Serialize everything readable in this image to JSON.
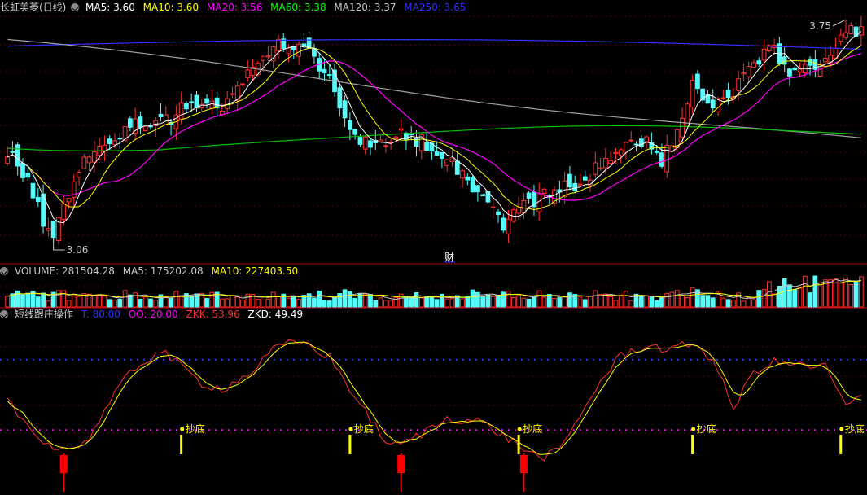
{
  "price_header": {
    "title": "长虹美菱(日线)",
    "items": [
      {
        "label": "MA5:",
        "value": "3.60",
        "color": "#ffffff"
      },
      {
        "label": "MA10:",
        "value": "3.60",
        "color": "#ffff00"
      },
      {
        "label": "MA20:",
        "value": "3.56",
        "color": "#ff00ff"
      },
      {
        "label": "MA60:",
        "value": "3.38",
        "color": "#00ff00"
      },
      {
        "label": "MA120:",
        "value": "3.37",
        "color": "#c8c8c8"
      },
      {
        "label": "MA250:",
        "value": "3.65",
        "color": "#3030ff"
      }
    ]
  },
  "volume_header": {
    "items": [
      {
        "label": "VOLUME:",
        "value": "281504.28",
        "color": "#c8c8c8"
      },
      {
        "label": "MA5:",
        "value": "175202.08",
        "color": "#c8c8c8"
      },
      {
        "label": "MA10:",
        "value": "227403.50",
        "color": "#ffff00"
      }
    ]
  },
  "indicator_header": {
    "title": "短线跟庄操作",
    "items": [
      {
        "label": "T:",
        "value": "80.00",
        "color": "#3030ff"
      },
      {
        "label": "OO:",
        "value": "20.00",
        "color": "#ff00ff"
      },
      {
        "label": "ZKK:",
        "value": "53.96",
        "color": "#ff3030"
      },
      {
        "label": "ZKD:",
        "value": "49.49",
        "color": "#ffffff"
      }
    ]
  },
  "chart_data": [
    {
      "type": "candlestick",
      "title": "长虹美菱(日线)",
      "high_label": "3.75",
      "low_label": "3.06",
      "event_marker": "财",
      "ylim": [
        3.06,
        3.75
      ],
      "ma_series": [
        {
          "name": "MA5",
          "color": "#ffffff"
        },
        {
          "name": "MA10",
          "color": "#ffff00"
        },
        {
          "name": "MA20",
          "color": "#ff00ff"
        },
        {
          "name": "MA60",
          "color": "#00ff00"
        },
        {
          "name": "MA120",
          "color": "#c8c8c8"
        },
        {
          "name": "MA250",
          "color": "#3030ff"
        }
      ],
      "up_color": "#ff3030",
      "down_color": "#54fcfc",
      "waypoints": [
        [
          0,
          3.35
        ],
        [
          4,
          3.25
        ],
        [
          8,
          3.08
        ],
        [
          10,
          3.12
        ],
        [
          14,
          3.3
        ],
        [
          20,
          3.38
        ],
        [
          26,
          3.43
        ],
        [
          32,
          3.45
        ],
        [
          37,
          3.5
        ],
        [
          42,
          3.48
        ],
        [
          46,
          3.55
        ],
        [
          52,
          3.68
        ],
        [
          58,
          3.66
        ],
        [
          62,
          3.6
        ],
        [
          65,
          3.5
        ],
        [
          68,
          3.38
        ],
        [
          72,
          3.35
        ],
        [
          78,
          3.4
        ],
        [
          86,
          3.33
        ],
        [
          92,
          3.22
        ],
        [
          97,
          3.12
        ],
        [
          102,
          3.19
        ],
        [
          108,
          3.22
        ],
        [
          114,
          3.27
        ],
        [
          120,
          3.35
        ],
        [
          125,
          3.38
        ],
        [
          128,
          3.3
        ],
        [
          131,
          3.42
        ],
        [
          134,
          3.55
        ],
        [
          138,
          3.48
        ],
        [
          142,
          3.52
        ],
        [
          146,
          3.63
        ],
        [
          150,
          3.65
        ],
        [
          154,
          3.58
        ],
        [
          158,
          3.62
        ],
        [
          161,
          3.64
        ],
        [
          165,
          3.72
        ]
      ],
      "ma_levels": {
        "MA60": [
          3.4,
          3.38
        ],
        "MA120": [
          3.68,
          3.37
        ],
        "MA250": [
          3.68,
          3.67
        ]
      }
    },
    {
      "type": "bar",
      "title": "VOLUME",
      "series": [
        {
          "name": "VOLUME",
          "color": "#c8c8c8"
        },
        {
          "name": "MA5",
          "color": "#c8c8c8"
        },
        {
          "name": "MA10",
          "color": "#ffff00"
        }
      ]
    },
    {
      "type": "line",
      "title": "短线跟庄操作",
      "ylim": [
        0,
        100
      ],
      "levels": [
        {
          "name": "T",
          "value": 80,
          "color": "#3030ff"
        },
        {
          "name": "OO",
          "value": 20,
          "color": "#ff00ff"
        }
      ],
      "series": [
        {
          "name": "ZKK",
          "color": "#ff3030"
        },
        {
          "name": "ZKD",
          "color": "#ffff00"
        }
      ],
      "signal_label": "抄底",
      "signal_color": "#ffff00"
    }
  ]
}
